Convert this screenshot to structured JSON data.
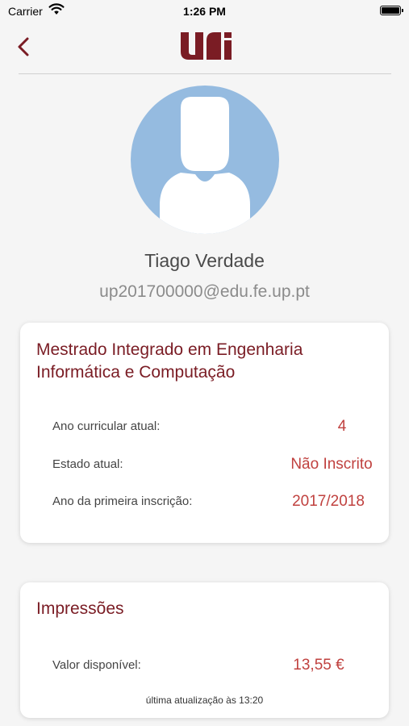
{
  "status_bar": {
    "carrier": "Carrier",
    "time": "1:26 PM"
  },
  "header": {
    "logo_text": "uni",
    "back_icon": "chevron-left-icon"
  },
  "profile": {
    "name": "Tiago Verdade",
    "email": "up201700000@edu.fe.up.pt",
    "avatar_icon": "person-silhouette-icon"
  },
  "course_card": {
    "title_line1": "Mestrado Integrado em Engenharia",
    "title_line2": "Informática e Computação",
    "rows": [
      {
        "label": "Ano curricular atual:",
        "value": "4"
      },
      {
        "label": "Estado atual:",
        "value": "Não Inscrito"
      },
      {
        "label": "Ano da primeira inscrição:",
        "value": "2017/2018"
      }
    ]
  },
  "print_card": {
    "title": "Impressões",
    "label": "Valor disponível:",
    "value": "13,55 €",
    "update_note": "última atualização às 13:20"
  },
  "colors": {
    "brand": "#7a1c24",
    "value": "#c0413f",
    "avatar_bg": "#95bbe0"
  }
}
